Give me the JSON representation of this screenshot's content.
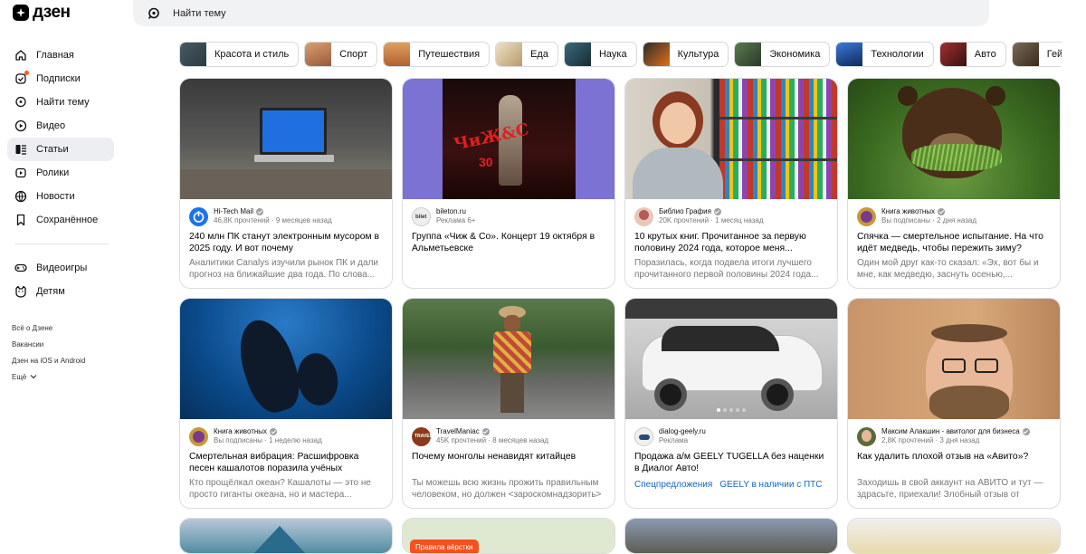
{
  "app": {
    "logo": "дзен"
  },
  "search": {
    "placeholder": "Найти тему"
  },
  "sidebar": {
    "items": [
      {
        "label": "Главная",
        "icon": "home-icon"
      },
      {
        "label": "Подписки",
        "icon": "subscriptions-icon"
      },
      {
        "label": "Найти тему",
        "icon": "find-topic-icon"
      },
      {
        "label": "Видео",
        "icon": "video-icon"
      },
      {
        "label": "Статьи",
        "icon": "articles-icon",
        "active": true
      },
      {
        "label": "Ролики",
        "icon": "shorts-icon"
      },
      {
        "label": "Новости",
        "icon": "news-icon"
      },
      {
        "label": "Сохранённое",
        "icon": "bookmark-icon"
      }
    ],
    "items2": [
      {
        "label": "Видеоигры",
        "icon": "gamepad-icon"
      },
      {
        "label": "Детям",
        "icon": "kids-icon"
      }
    ],
    "footer": [
      "Всё о Дзене",
      "Вакансии",
      "Дзен на iOS и Android",
      "Ещё"
    ]
  },
  "chips": [
    {
      "label": "Красота и стиль",
      "color": "#3a4a52"
    },
    {
      "label": "Спорт",
      "color": "#c8865a"
    },
    {
      "label": "Путешествия",
      "color": "#c97a3a"
    },
    {
      "label": "Еда",
      "color": "#d9c8a8"
    },
    {
      "label": "Наука",
      "color": "#2b4a56"
    },
    {
      "label": "Культура",
      "color": "#d06020"
    },
    {
      "label": "Экономика",
      "color": "#3c5d40"
    },
    {
      "label": "Технологии",
      "color": "#2255a8"
    },
    {
      "label": "Авто",
      "color": "#7a2020"
    },
    {
      "label": "Гейм",
      "color": "#5a4a3a"
    }
  ],
  "cards": [
    {
      "source": "Hi-Tech Mail",
      "verified": true,
      "sub": "46,8K прочтений · 9 месяцев назад",
      "title": "240 млн ПК станут электронным мусором в 2025 году. И вот почему",
      "desc": "Аналитики Canalys изучили рынок ПК и дали прогноз на ближайшие два года. По слова...",
      "color": "#1a73e8"
    },
    {
      "source": "bileton.ru",
      "verified": false,
      "sub": "Реклама 6+",
      "title": "Группа «Чиж & Co». Концерт 19 октября в Альметьевске",
      "desc": "",
      "color": "#7b72d4"
    },
    {
      "source": "Библио Графия",
      "verified": true,
      "sub": "20K прочтений · 1 месяц назад",
      "title": "10 крутых книг. Прочитанное за первую половину 2024 года, которое меня...",
      "desc": "Поразилась, когда подвела итоги лучшего прочитанного первой половины 2024 года...",
      "color": "#b45a5a"
    },
    {
      "source": "Книга животных",
      "verified": true,
      "sub": "Вы подписаны · 2 дня назад",
      "title": "Спячка — смертельное испытание. На что идёт медведь, чтобы пережить зиму?",
      "desc": "Один мой друг как-то сказал: «Эх, вот бы и мне, как медведю, заснуть осенью,...",
      "color": "#c79a3a"
    },
    {
      "source": "Книга животных",
      "verified": true,
      "sub": "Вы подписаны · 1 неделю назад",
      "title": "Смертельная вибрация: Расшифровка песен кашалотов поразила учёных",
      "desc": "Кто прощёлкал океан? Кашалоты — это не просто гиганты океана, но и мастера...",
      "color": "#c79a3a"
    },
    {
      "source": "TravelManiac",
      "verified": true,
      "sub": "45K прочтений · 8 месяцев назад",
      "title": "Почему монголы ненавидят китайцев",
      "desc": "Ты можешь всю жизнь прожить правильным человеком, но должен <зароскомнадзорить> хотя бы одного...",
      "color": "#8a3a1a"
    },
    {
      "source": "dialog-geely.ru",
      "verified": false,
      "sub": "Реклама",
      "title": "Продажа а/м GEELY TUGELLA без наценки в Диалог Авто!",
      "desc": "",
      "tags": [
        "Спецпредложения",
        "GEELY в наличии с ПТС"
      ],
      "color": "#2a4a7a"
    },
    {
      "source": "Максим Алакшин - авитолог для бизнеса",
      "verified": true,
      "sub": "2,8K прочтений · 3 дня назад",
      "title": "Как удалить плохой отзыв на «Авито»?",
      "desc": "Заходишь в свой аккаунт на АВИТО и тут — здрасьте, приехали! Злобный отзыв от хейтера, где он в пух и прах распекает и...",
      "color": "#5a6a3a"
    }
  ],
  "card_row3": {
    "badge": "Правила вёрстки"
  }
}
